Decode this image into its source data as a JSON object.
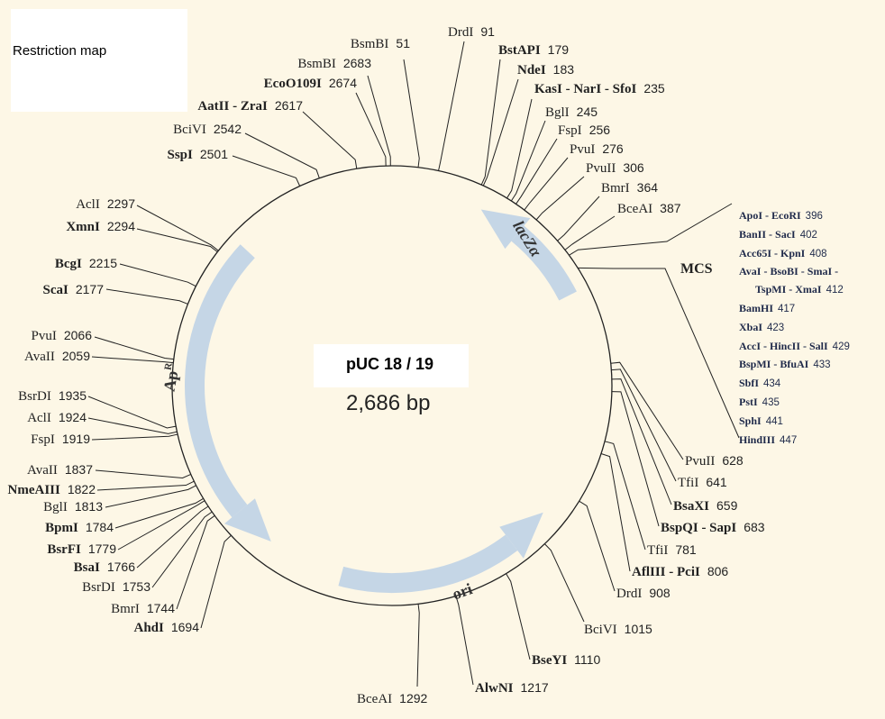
{
  "header": {
    "title": "Restriction map"
  },
  "plasmid": {
    "name": "pUC 18 / 19",
    "size": "2,686 bp",
    "length_bp": 2686
  },
  "colors": {
    "background": "#fdf7e6",
    "feature_arrow": "#c5d6e6",
    "line": "#222222",
    "mcs_text": "#1f2a4a"
  },
  "features": [
    {
      "name": "lacZα",
      "label_main": "lacZ",
      "label_suffix": "α",
      "start": 470,
      "end": 200,
      "direction": "counterclockwise"
    },
    {
      "name": "ApR",
      "label_main": "Ap",
      "label_suffix": "R",
      "start": 2335,
      "end": 1625,
      "direction": "counterclockwise"
    },
    {
      "name": "ori",
      "label_main": "ori",
      "label_suffix": "",
      "start": 1455,
      "end": 970,
      "direction": "counterclockwise"
    }
  ],
  "sites": [
    {
      "name": "BsmBI",
      "pos": "51",
      "bold": false
    },
    {
      "name": "BsmBI",
      "pos": "2683",
      "bold": false
    },
    {
      "name": "EcoO109I",
      "pos": "2674",
      "bold": true
    },
    {
      "name": "AatII - ZraI",
      "pos": "2617",
      "bold": true
    },
    {
      "name": "BciVI",
      "pos": "2542",
      "bold": false
    },
    {
      "name": "SspI",
      "pos": "2501",
      "bold": true
    },
    {
      "name": "AclI",
      "pos": "2297",
      "bold": false
    },
    {
      "name": "XmnI",
      "pos": "2294",
      "bold": true
    },
    {
      "name": "BcgI",
      "pos": "2215",
      "bold": true
    },
    {
      "name": "ScaI",
      "pos": "2177",
      "bold": true
    },
    {
      "name": "PvuI",
      "pos": "2066",
      "bold": false
    },
    {
      "name": "AvaII",
      "pos": "2059",
      "bold": false
    },
    {
      "name": "BsrDI",
      "pos": "1935",
      "bold": false
    },
    {
      "name": "AclI",
      "pos": "1924",
      "bold": false
    },
    {
      "name": "FspI",
      "pos": "1919",
      "bold": false
    },
    {
      "name": "AvaII",
      "pos": "1837",
      "bold": false
    },
    {
      "name": "NmeAIII",
      "pos": "1822",
      "bold": true
    },
    {
      "name": "BglI",
      "pos": "1813",
      "bold": false
    },
    {
      "name": "BpmI",
      "pos": "1784",
      "bold": true
    },
    {
      "name": "BsrFI",
      "pos": "1779",
      "bold": true
    },
    {
      "name": "BsaI",
      "pos": "1766",
      "bold": true
    },
    {
      "name": "BsrDI",
      "pos": "1753",
      "bold": false
    },
    {
      "name": "BmrI",
      "pos": "1744",
      "bold": false
    },
    {
      "name": "AhdI",
      "pos": "1694",
      "bold": true
    },
    {
      "name": "BceAI",
      "pos": "1292",
      "bold": false
    },
    {
      "name": "AlwNI",
      "pos": "1217",
      "bold": true
    },
    {
      "name": "BseYI",
      "pos": "1110",
      "bold": true
    },
    {
      "name": "BciVI",
      "pos": "1015",
      "bold": false
    },
    {
      "name": "DrdI",
      "pos": "908",
      "bold": false
    },
    {
      "name": "AflIII - PciI",
      "pos": "806",
      "bold": true
    },
    {
      "name": "TfiI",
      "pos": "781",
      "bold": false
    },
    {
      "name": "BspQI - SapI",
      "pos": "683",
      "bold": true
    },
    {
      "name": "BsaXI",
      "pos": "659",
      "bold": true
    },
    {
      "name": "TfiI",
      "pos": "641",
      "bold": false
    },
    {
      "name": "PvuII",
      "pos": "628",
      "bold": false
    },
    {
      "name": "DrdI",
      "pos": "91",
      "bold": false
    },
    {
      "name": "BstAPI",
      "pos": "179",
      "bold": true
    },
    {
      "name": "NdeI",
      "pos": "183",
      "bold": true
    },
    {
      "name": "KasI - NarI - SfoI",
      "pos": "235",
      "bold": true
    },
    {
      "name": "BglI",
      "pos": "245",
      "bold": false
    },
    {
      "name": "FspI",
      "pos": "256",
      "bold": false
    },
    {
      "name": "PvuI",
      "pos": "276",
      "bold": false
    },
    {
      "name": "PvuII",
      "pos": "306",
      "bold": false
    },
    {
      "name": "BmrI",
      "pos": "364",
      "bold": false
    },
    {
      "name": "BceAI",
      "pos": "387",
      "bold": false
    }
  ],
  "mcs": {
    "label": "MCS",
    "sites": [
      {
        "name": "ApoI - EcoRI",
        "pos": "396"
      },
      {
        "name": "BanII - SacI",
        "pos": "402"
      },
      {
        "name": "Acc65I - KpnI",
        "pos": "408"
      },
      {
        "name": "AvaI - BsoBI - SmaI -",
        "pos": ""
      },
      {
        "name": "TspMI - XmaI",
        "pos": "412"
      },
      {
        "name": "BamHI",
        "pos": "417"
      },
      {
        "name": "XbaI",
        "pos": "423"
      },
      {
        "name": "AccI - HincII - SalI",
        "pos": "429"
      },
      {
        "name": "BspMI - BfuAI",
        "pos": "433"
      },
      {
        "name": "SbfI",
        "pos": "434"
      },
      {
        "name": "PstI",
        "pos": "435"
      },
      {
        "name": "SphI",
        "pos": "441"
      },
      {
        "name": "HindIII",
        "pos": "447"
      }
    ]
  }
}
